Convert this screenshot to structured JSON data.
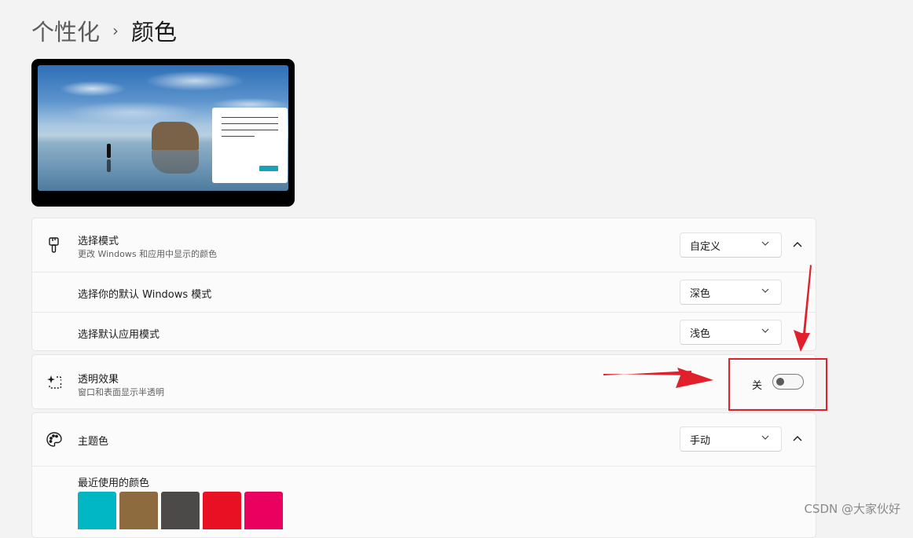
{
  "breadcrumb": {
    "parent": "个性化",
    "separator": "›",
    "current": "颜色"
  },
  "mode_section": {
    "icon": "paintbrush-icon",
    "title": "选择模式",
    "subtitle": "更改 Windows 和应用中显示的颜色",
    "dropdown_value": "自定义",
    "expanded": true,
    "windows_mode": {
      "label": "选择你的默认 Windows 模式",
      "value": "深色"
    },
    "app_mode": {
      "label": "选择默认应用模式",
      "value": "浅色"
    }
  },
  "transparency": {
    "icon": "sparkle-selection-icon",
    "title": "透明效果",
    "subtitle": "窗口和表面显示半透明",
    "toggle_label": "关",
    "enabled": false
  },
  "accent": {
    "icon": "palette-icon",
    "title": "主题色",
    "dropdown_value": "手动",
    "expanded": true,
    "recent_label": "最近使用的颜色",
    "recent_colors": [
      "#00b7c3",
      "#8e6a3f",
      "#4c4a48",
      "#e81123",
      "#ea005e"
    ]
  },
  "watermark": "CSDN @大家伙好",
  "colors": {
    "annotation": "#e0202a",
    "page_background": "#f3f3f3",
    "card_background": "#fbfbfb"
  }
}
